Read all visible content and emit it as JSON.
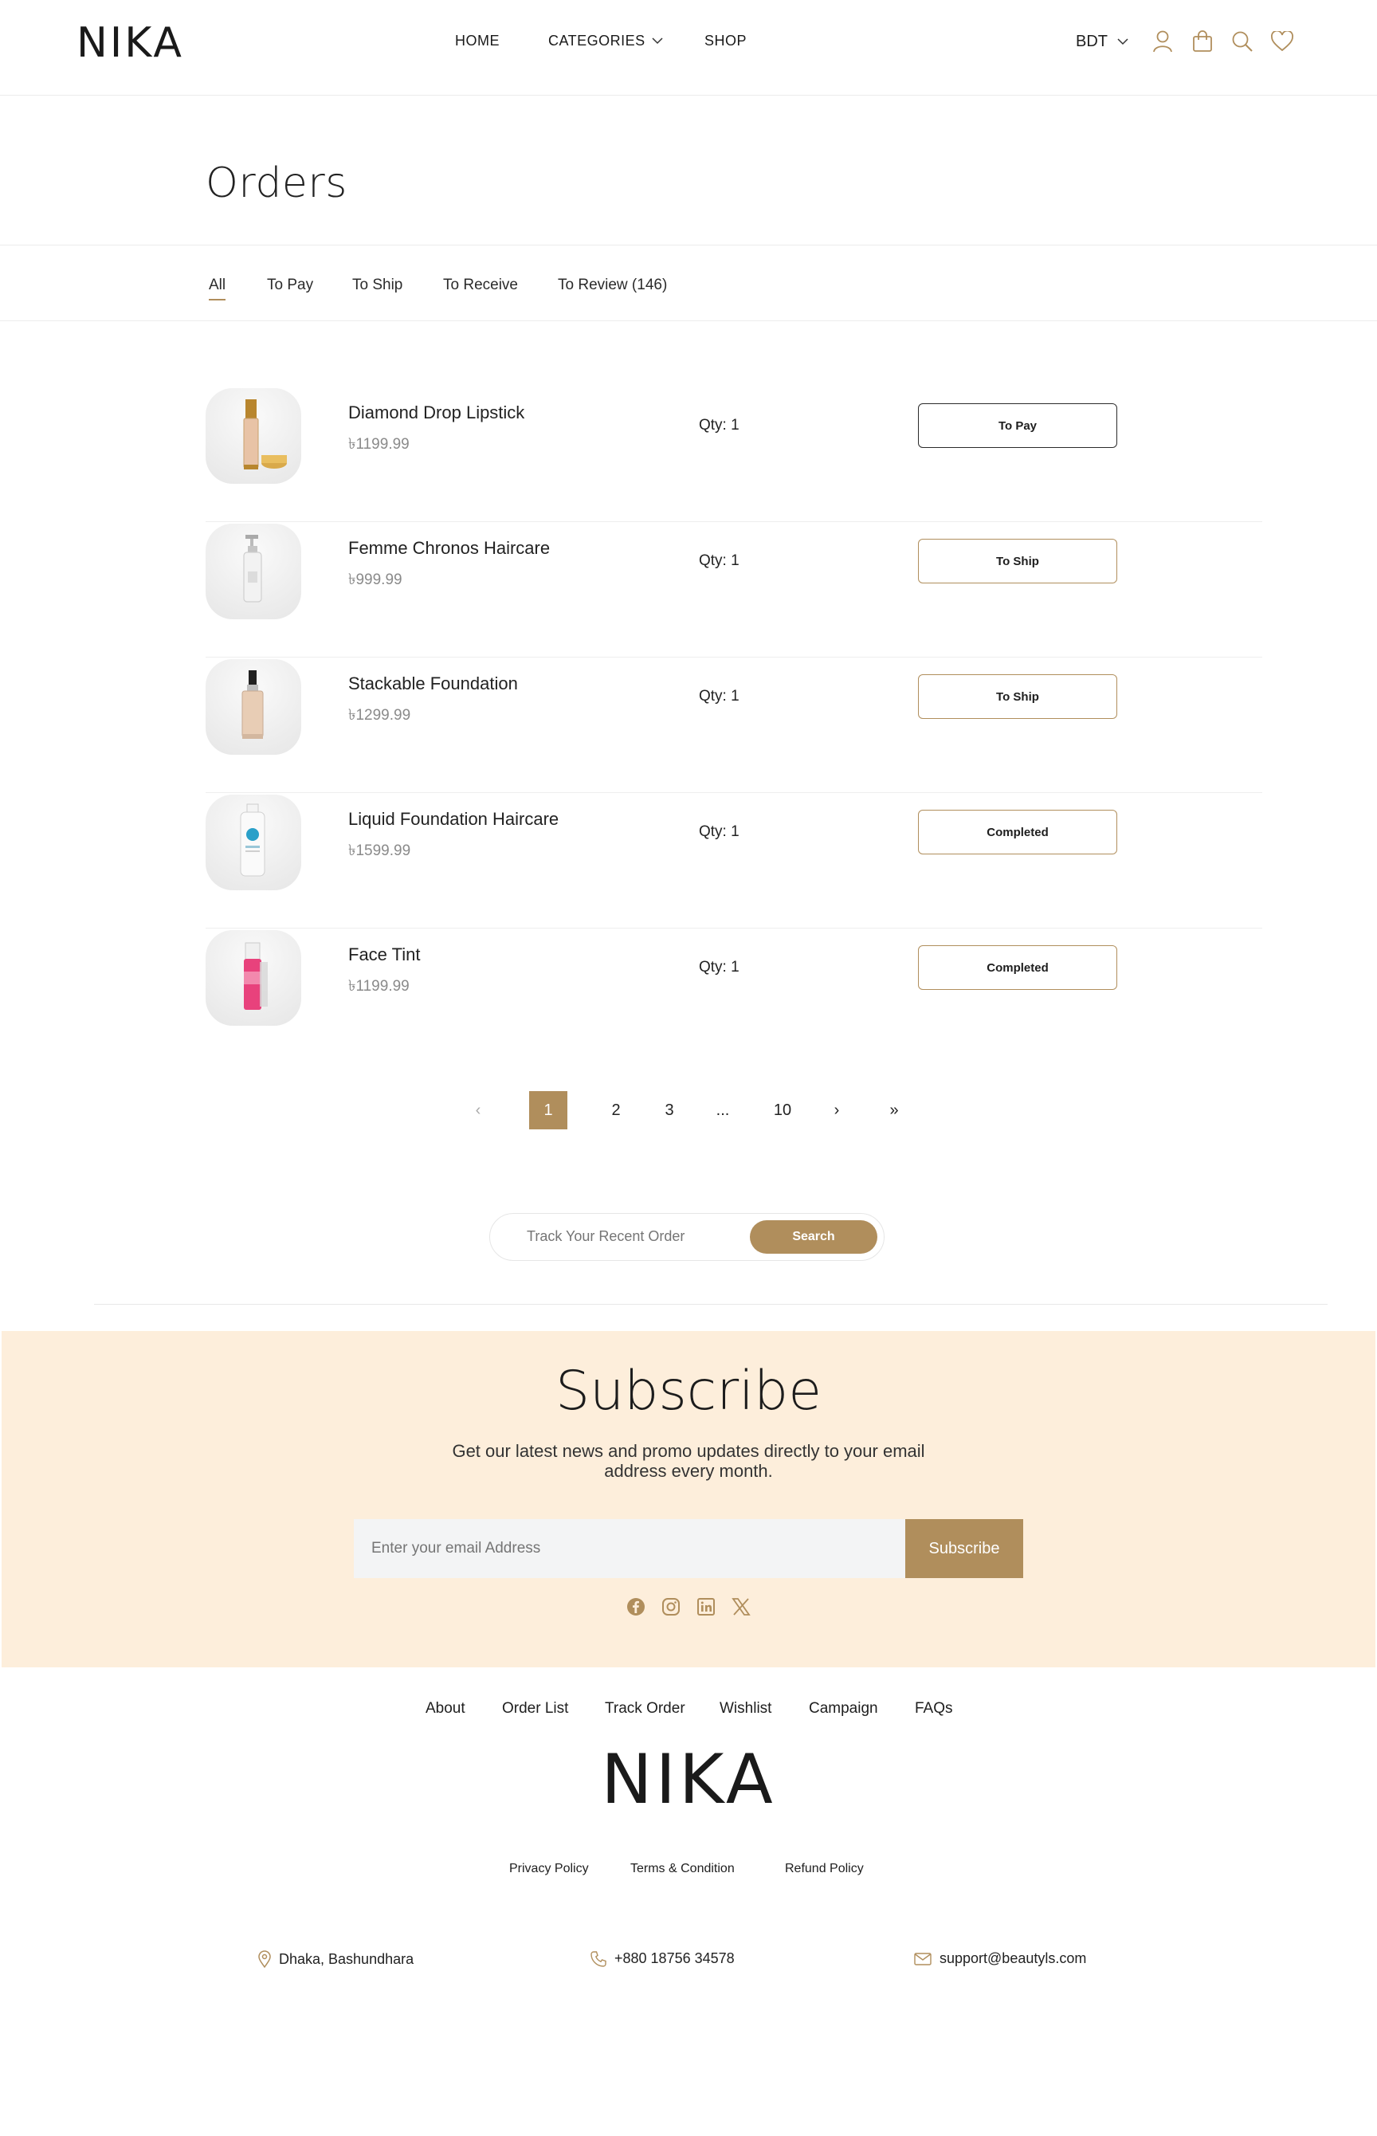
{
  "header": {
    "logo": "NIKA",
    "nav": {
      "home": "HOME",
      "categories": "CATEGORIES",
      "shop": "SHOP"
    },
    "currency": "BDT",
    "icons": [
      "user-icon",
      "bag-icon",
      "search-icon",
      "heart-icon"
    ],
    "accent_color": "#b08e5c"
  },
  "page": {
    "title": "Orders"
  },
  "tabs": [
    {
      "label": "All",
      "active": true
    },
    {
      "label": "To Pay"
    },
    {
      "label": "To Ship"
    },
    {
      "label": "To Receive"
    },
    {
      "label": "To Review (146)"
    }
  ],
  "orders": [
    {
      "name": "Diamond Drop Lipstick",
      "price": "৳1199.99",
      "qty": "Qty: 1",
      "status": "To Pay",
      "product_icon": "lipstick"
    },
    {
      "name": "Femme Chronos Haircare",
      "price": "৳999.99",
      "qty": "Qty: 1",
      "status": "To Ship",
      "product_icon": "pump-bottle"
    },
    {
      "name": "Stackable Foundation",
      "price": "৳1299.99",
      "qty": "Qty: 1",
      "status": "To Ship",
      "product_icon": "foundation-bottle"
    },
    {
      "name": "Liquid Foundation Haircare",
      "price": "৳1599.99",
      "qty": "Qty: 1",
      "status": "Completed",
      "product_icon": "lotion-bottle"
    },
    {
      "name": "Face Tint",
      "price": "৳1199.99",
      "qty": "Qty: 1",
      "status": "Completed",
      "product_icon": "tint-bottle"
    }
  ],
  "pagination": {
    "prev": "‹",
    "pages": [
      "1",
      "2",
      "3",
      "...",
      "10"
    ],
    "current": "1",
    "next": "›",
    "last": "»"
  },
  "track": {
    "placeholder": "Track Your Recent Order",
    "button": "Search"
  },
  "subscribe": {
    "title": "Subscribe",
    "text": "Get our latest news and promo updates directly to your email address every month.",
    "placeholder": "Enter your email Address",
    "button": "Subscribe",
    "background": "#fdeedb",
    "socials": [
      "facebook-icon",
      "instagram-icon",
      "linkedin-icon",
      "x-icon"
    ]
  },
  "footer": {
    "links": [
      "About",
      "Order List",
      "Track Order",
      "Wishlist",
      "Campaign",
      "FAQs"
    ],
    "logo": "NIKA",
    "legal": [
      "Privacy Policy",
      "Terms & Condition",
      "Refund Policy"
    ],
    "address": "Dhaka, Bashundhara",
    "phone": "+880 18756 34578",
    "email": "support@beautyls.com"
  }
}
